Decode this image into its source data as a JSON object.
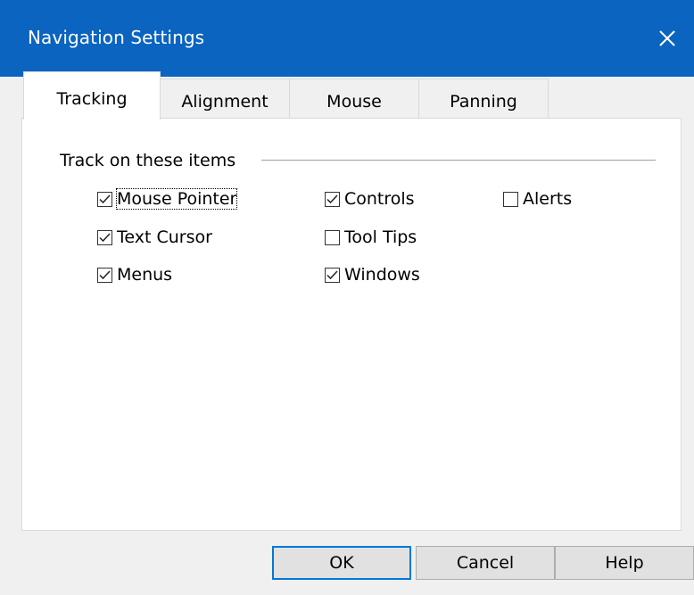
{
  "window": {
    "title": "Navigation Settings"
  },
  "tabs": [
    {
      "label": "Tracking",
      "active": true
    },
    {
      "label": "Alignment",
      "active": false
    },
    {
      "label": "Mouse",
      "active": false
    },
    {
      "label": "Panning",
      "active": false
    }
  ],
  "tracking": {
    "group_label": "Track on these items",
    "options": [
      {
        "label": "Mouse Pointer",
        "checked": true,
        "focused": true
      },
      {
        "label": "Text Cursor",
        "checked": true
      },
      {
        "label": "Menus",
        "checked": true
      },
      {
        "label": "Controls",
        "checked": true
      },
      {
        "label": "Tool Tips",
        "checked": false
      },
      {
        "label": "Windows",
        "checked": true
      },
      {
        "label": "Alerts",
        "checked": false
      }
    ]
  },
  "buttons": {
    "ok": "OK",
    "cancel": "Cancel",
    "help": "Help"
  },
  "colors": {
    "titlebar": "#0a64c0",
    "accent": "#0078d7",
    "dialog_bg": "#f0f0f0"
  }
}
